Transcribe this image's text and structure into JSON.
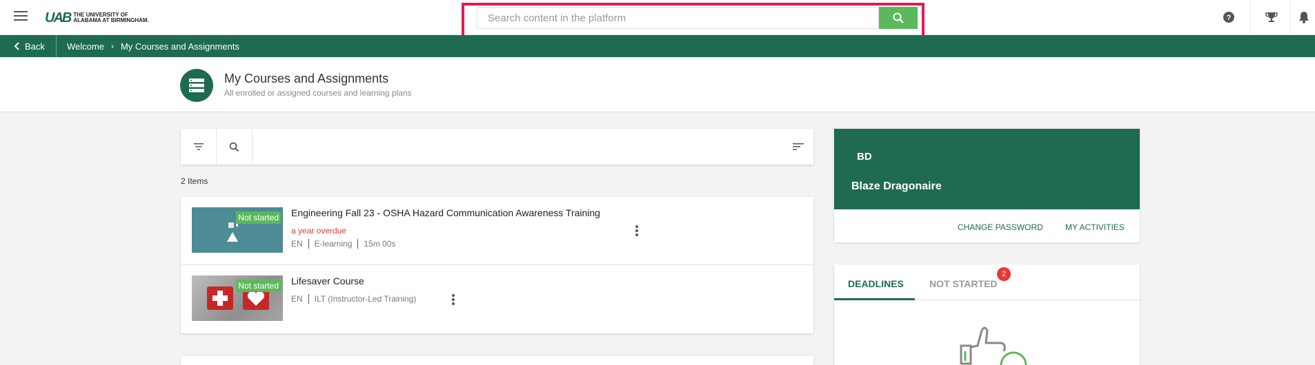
{
  "header": {
    "logo_mark": "UAB",
    "logo_line1": "The University of",
    "logo_line2": "Alabama at Birmingham.",
    "search_placeholder": "Search content in the platform"
  },
  "breadcrumb": {
    "back_label": "Back",
    "items": [
      "Welcome",
      "My Courses and Assignments"
    ]
  },
  "page": {
    "title": "My Courses and Assignments",
    "subtitle": "All enrolled or assigned courses and learning plans"
  },
  "list": {
    "items_count": "2 Items",
    "courses": [
      {
        "title": "Engineering Fall 23 - OSHA Hazard Communication Awareness Training",
        "status": "Not started",
        "overdue": "a year overdue",
        "language": "EN",
        "type": "E-learning",
        "duration": "15m 00s"
      },
      {
        "title": "Lifesaver Course",
        "status": "Not started",
        "language": "EN",
        "type": "ILT (Instructor-Led Training)"
      }
    ]
  },
  "profile": {
    "initials": "BD",
    "name": "Blaze Dragonaire",
    "change_password": "CHANGE PASSWORD",
    "my_activities": "MY ACTIVITIES"
  },
  "deadlines": {
    "tab_deadlines": "DEADLINES",
    "tab_not_started": "NOT STARTED",
    "not_started_count": "2"
  },
  "colors": {
    "brand_green": "#1e6b52",
    "accent_green": "#5cb85c",
    "highlight": "#e8194d",
    "alert_red": "#e53935"
  }
}
